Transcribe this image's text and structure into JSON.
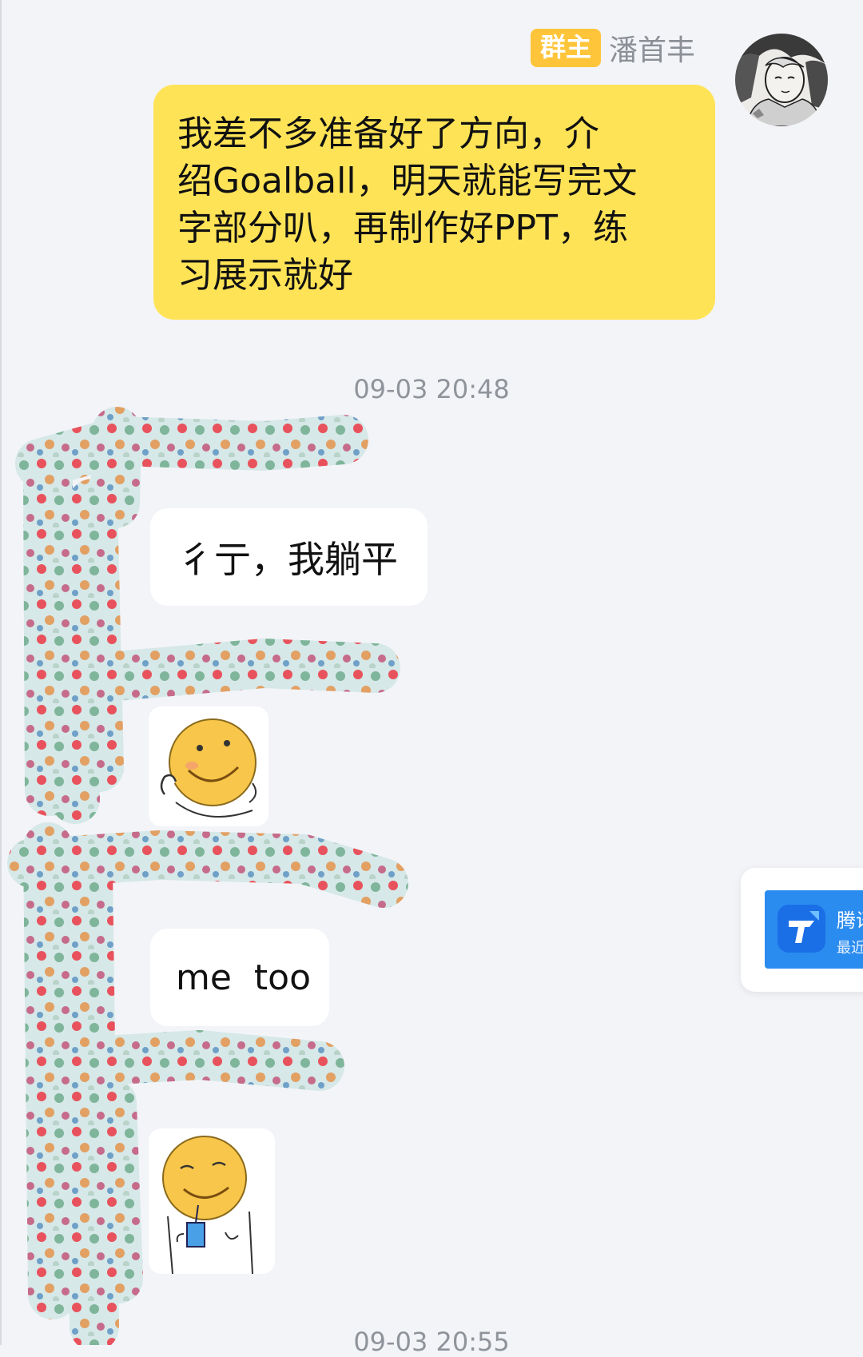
{
  "message_self": {
    "role_badge": "群主",
    "sender_name": "潘首丰",
    "lines": [
      "我差不多准备好了方向，介",
      "绍Goalball，明天就能写完文",
      "字部分叭，再制作好PPT，练",
      "习展示就好"
    ]
  },
  "timestamps": {
    "first": "09-03 20:48",
    "second": "09-03 20:55"
  },
  "messages_other": {
    "reply_1": "彳亍，我躺平",
    "reply_2": "me  too"
  },
  "float_card": {
    "title": "腾讯",
    "subtitle": "最近"
  },
  "colors": {
    "background": "#f3f4f8",
    "self_bubble": "#ffe357",
    "badge": "#ffc53a",
    "float_card_blue": "#2b8cf0"
  }
}
